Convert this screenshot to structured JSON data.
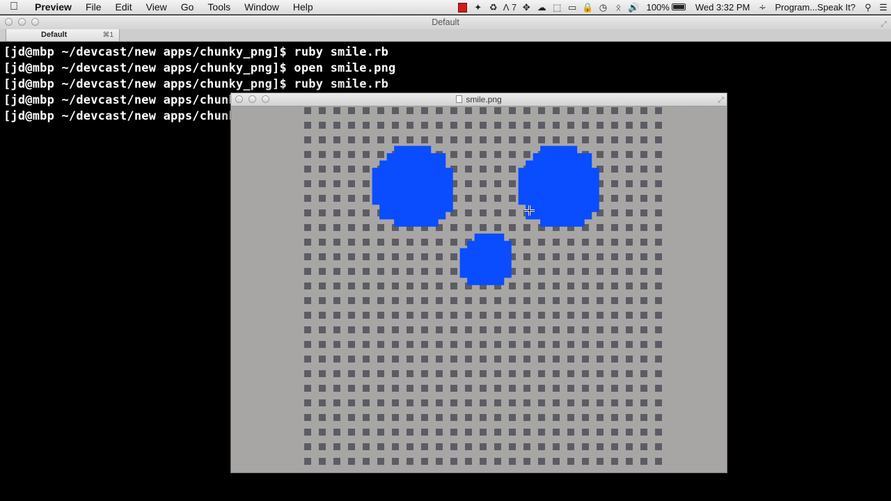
{
  "menubar": {
    "app_name": "Preview",
    "menus": [
      "File",
      "Edit",
      "View",
      "Go",
      "Tools",
      "Window",
      "Help"
    ],
    "status": {
      "adobe_count": "7",
      "battery": "100%",
      "clock": "Wed 3:32 PM",
      "user": "Program...Speak It?"
    }
  },
  "terminal": {
    "title": "Default",
    "tab": {
      "label": "Default",
      "shortcut": "⌘1"
    },
    "lines": [
      "[jd@mbp ~/devcast/new apps/chunky_png]$ ruby smile.rb",
      "[jd@mbp ~/devcast/new apps/chunky_png]$ open smile.png",
      "[jd@mbp ~/devcast/new apps/chunky_png]$ ruby smile.rb",
      "[jd@mbp ~/devcast/new apps/chunky_png]$ ",
      "[jd@mbp ~/devcast/new apps/chunky_png]$ "
    ]
  },
  "preview": {
    "title": "smile.png",
    "image": {
      "background_color": "#a8a6a5",
      "grid_square_color": "#5c5c64",
      "circle_color": "#0a4cff",
      "grid": {
        "columns": 25,
        "rows": 25
      },
      "circles": [
        {
          "name": "left-eye",
          "cx": 7.5,
          "cy": 5.5,
          "r": 2.85
        },
        {
          "name": "right-eye",
          "cx": 17.5,
          "cy": 5.5,
          "r": 2.85
        },
        {
          "name": "nose",
          "cx": 12.5,
          "cy": 10.5,
          "r": 1.85
        }
      ]
    }
  },
  "colors": {
    "terminal_bg": "#000000",
    "terminal_text": "#ffffff",
    "menubar_bg": "#e8e8e8"
  }
}
